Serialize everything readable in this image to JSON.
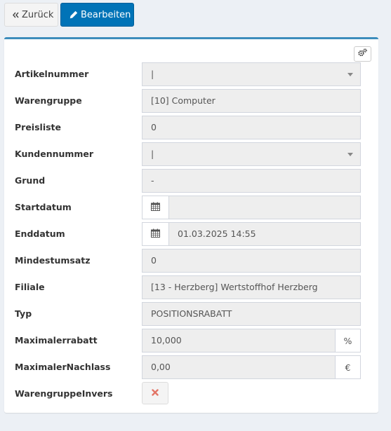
{
  "toolbar": {
    "back_label": "Zurück",
    "edit_label": "Bearbeiten",
    "back_icon": "double-chevron-left-icon",
    "edit_icon": "pencil-icon"
  },
  "box": {
    "settings_icon": "gears-icon",
    "accent_color": "#3c8dbc"
  },
  "fields": {
    "artikelnummer": {
      "label": "Artikelnummer",
      "value": "|"
    },
    "warengruppe": {
      "label": "Warengruppe",
      "value": "[10] Computer"
    },
    "preisliste": {
      "label": "Preisliste",
      "value": "0"
    },
    "kundennummer": {
      "label": "Kundennummer",
      "value": "|"
    },
    "grund": {
      "label": "Grund",
      "value": "-"
    },
    "startdatum": {
      "label": "Startdatum",
      "value": ""
    },
    "enddatum": {
      "label": "Enddatum",
      "value": "01.03.2025 14:55"
    },
    "mindestumsatz": {
      "label": "Mindestumsatz",
      "value": "0"
    },
    "filiale": {
      "label": "Filiale",
      "value": "[13 - Herzberg] Wertstoffhof Herzberg"
    },
    "typ": {
      "label": "Typ",
      "value": "POSITIONSRABATT"
    },
    "maximalerrabatt": {
      "label": "Maximalerrabatt",
      "value": "10,000",
      "unit": "%"
    },
    "maximalernachlass": {
      "label": "MaximalerNachlass",
      "value": "0,00",
      "unit": "€"
    },
    "warengruppeinvers": {
      "label": "WarengruppeInvers",
      "checked": false,
      "icon": "x-icon",
      "icon_color": "#dd4b39"
    }
  }
}
